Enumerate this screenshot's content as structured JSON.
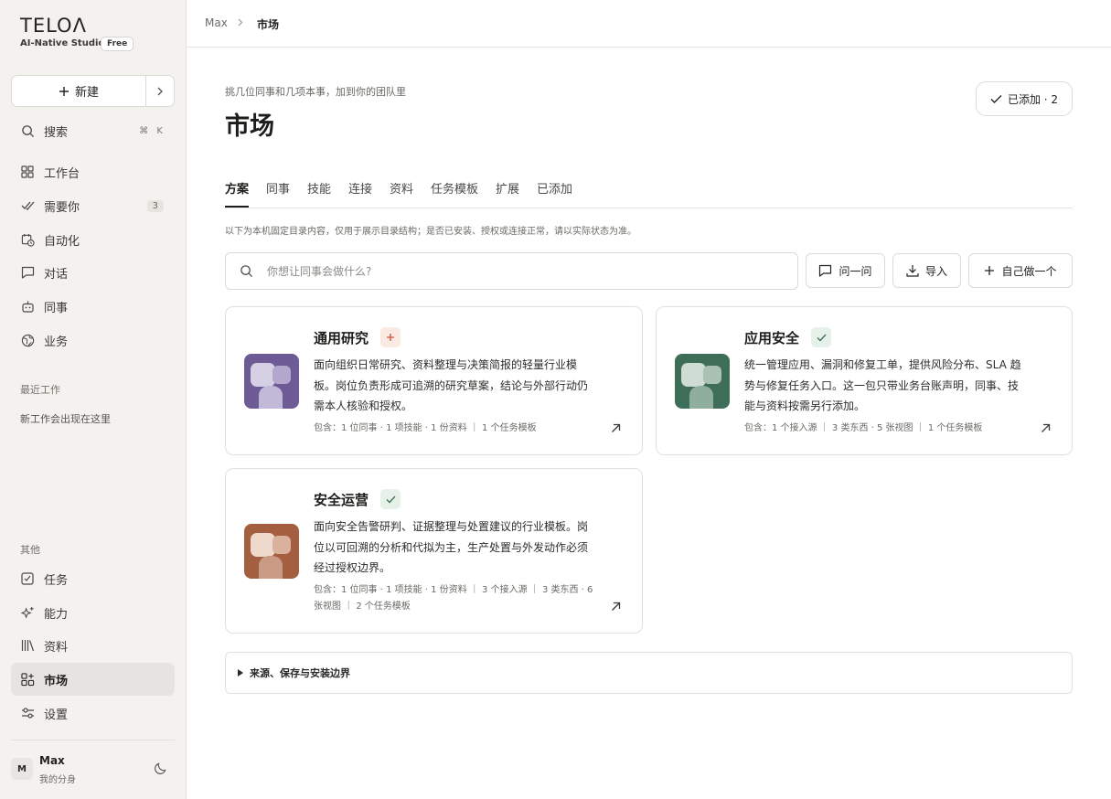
{
  "sidebar": {
    "logo": "TELOΛ",
    "subtitle": "AI-Native Studio",
    "plan_badge": "Free",
    "new_button": "新建",
    "search": {
      "label": "搜索",
      "shortcut": "⌘ K"
    },
    "nav": [
      {
        "label": "工作台",
        "icon": "grid-icon"
      },
      {
        "label": "需要你",
        "icon": "double-check-icon",
        "count": "3"
      },
      {
        "label": "自动化",
        "icon": "calendar-clock-icon"
      },
      {
        "label": "对话",
        "icon": "chat-icon"
      },
      {
        "label": "同事",
        "icon": "robot-icon"
      },
      {
        "label": "业务",
        "icon": "globe-icon"
      }
    ],
    "recent_label": "最近工作",
    "recent_empty": "新工作会出现在这里",
    "other_label": "其他",
    "other": [
      {
        "label": "任务",
        "icon": "checkbox-icon"
      },
      {
        "label": "能力",
        "icon": "sparkles-icon"
      },
      {
        "label": "资料",
        "icon": "library-icon"
      },
      {
        "label": "市场",
        "icon": "apps-plus-icon",
        "active": true
      },
      {
        "label": "设置",
        "icon": "sliders-icon"
      }
    ],
    "user": {
      "initial": "M",
      "name": "Max",
      "sub": "我的分身"
    }
  },
  "breadcrumb": {
    "root": "Max",
    "current": "市场"
  },
  "header": {
    "eyebrow": "挑几位同事和几项本事，加到你的团队里",
    "title": "市场",
    "added_button": "已添加 · 2"
  },
  "tabs": [
    "方案",
    "同事",
    "技能",
    "连接",
    "资料",
    "任务模板",
    "扩展",
    "已添加"
  ],
  "notice": "以下为本机固定目录内容，仅用于展示目录结构；是否已安装、授权或连接正常，请以实际状态为准。",
  "search": {
    "placeholder": "你想让同事会做什么?"
  },
  "toolbar": {
    "ask": "问一问",
    "import": "导入",
    "create": "自己做一个"
  },
  "cards": [
    {
      "title": "通用研究",
      "status": "add",
      "desc": "面向组织日常研究、资料整理与决策简报的轻量行业模板。岗位负责形成可追溯的研究草案，结论与外部行动仍需本人核验和授权。",
      "meta": "包含：1 位同事 · 1 项技能 · 1 份资料 ｜ 1 个任务模板",
      "colors": {
        "bg": "#6e5a94",
        "head": "#d6d0e4",
        "head2": "#b3a8cc",
        "body": "#c2b8d8"
      }
    },
    {
      "title": "应用安全",
      "status": "ok",
      "desc": "统一管理应用、漏洞和修复工单，提供风险分布、SLA 趋势与修复任务入口。这一包只带业务台账声明，同事、技能与资料按需另行添加。",
      "meta": "包含：1 个接入源 ｜ 3 类东西 · 5 张视图 ｜ 1 个任务模板",
      "colors": {
        "bg": "#3f6e58",
        "head": "#cfdcd4",
        "head2": "#a9c2b4",
        "body": "#8fae9d"
      }
    },
    {
      "title": "安全运营",
      "status": "ok",
      "desc": "面向安全告警研判、证据整理与处置建议的行业模板。岗位以可回溯的分析和代拟为主，生产处置与外发动作必须经过授权边界。",
      "meta": "包含：1 位同事 · 1 项技能 · 1 份资料 ｜ 3 个接入源 ｜ 3 类东西 · 6 张视图 ｜ 2 个任务模板",
      "colors": {
        "bg": "#a35f3f",
        "head": "#efd8cc",
        "head2": "#d9b19d",
        "body": "#c99a84"
      }
    }
  ],
  "accordion": "来源、保存与安装边界"
}
